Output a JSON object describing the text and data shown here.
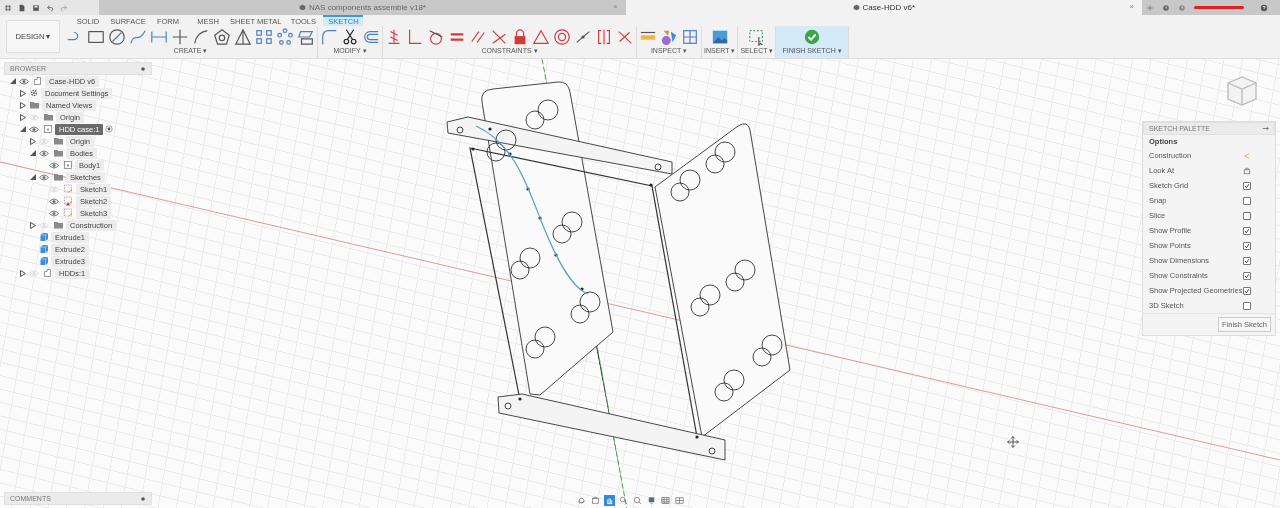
{
  "top_bar": {
    "document_tabs": [
      {
        "title": "NAS components assemble v18*",
        "close": "×",
        "selected": false
      },
      {
        "title": "Case-HDD v6*",
        "close": "×",
        "selected": true
      }
    ]
  },
  "toolbar": {
    "workspace": "DESIGN ▾",
    "tabs": [
      {
        "label": "SOLID",
        "selected": false
      },
      {
        "label": "SURFACE",
        "selected": false
      },
      {
        "label": "FORM",
        "selected": false
      },
      {
        "label": "MESH",
        "selected": false
      },
      {
        "label": "SHEET METAL",
        "selected": false
      },
      {
        "label": "TOOLS",
        "selected": false
      },
      {
        "label": "SKETCH",
        "selected": true
      }
    ],
    "groups": [
      {
        "label": "CREATE ▾",
        "kind": "create"
      },
      {
        "label": "MODIFY ▾",
        "kind": "modify"
      },
      {
        "label": "CONSTRAINTS ▾",
        "kind": "constraints"
      },
      {
        "label": "INSPECT ▾",
        "kind": "inspect"
      },
      {
        "label": "INSERT ▾",
        "kind": "insert"
      },
      {
        "label": "SELECT ▾",
        "kind": "select"
      },
      {
        "label": "FINISH SKETCH ▾",
        "kind": "finish"
      }
    ]
  },
  "browser": {
    "title": "BROWSER",
    "tree": [
      {
        "label": "Case-HDD v6",
        "kind": "component",
        "expanded": true,
        "visible": true,
        "selected": false,
        "children": [
          {
            "label": "Document Settings",
            "kind": "settings",
            "expanded": false,
            "selected": false
          },
          {
            "label": "Named Views",
            "kind": "folder",
            "expanded": false,
            "selected": false
          },
          {
            "label": "Origin",
            "kind": "folder",
            "expanded": false,
            "visible": false,
            "selected": false
          },
          {
            "label": "HDD case:1",
            "kind": "body",
            "expanded": true,
            "visible": true,
            "selected": true,
            "children": [
              {
                "label": "Origin",
                "kind": "folder",
                "expanded": false,
                "visible": false,
                "selected": false
              },
              {
                "label": "Bodies",
                "kind": "folder",
                "expanded": true,
                "visible": true,
                "selected": false,
                "children": [
                  {
                    "label": "Body1",
                    "kind": "body",
                    "visible": true,
                    "selected": false
                  }
                ]
              },
              {
                "label": "Sketches",
                "kind": "folder",
                "expanded": true,
                "visible": true,
                "selected": false,
                "children": [
                  {
                    "label": "Sketch1",
                    "kind": "sketch",
                    "visible": false,
                    "warning": false,
                    "selected": false
                  },
                  {
                    "label": "Sketch2",
                    "kind": "sketch",
                    "visible": true,
                    "warning": true,
                    "selected": false
                  },
                  {
                    "label": "Sketch3",
                    "kind": "sketch",
                    "visible": true,
                    "warning": false,
                    "selected": false
                  }
                ]
              },
              {
                "label": "Construction",
                "kind": "folder",
                "expanded": false,
                "visible": false,
                "selected": false
              },
              {
                "label": "Extrude1",
                "kind": "extrude",
                "selected": false
              },
              {
                "label": "Extrude2",
                "kind": "extrude",
                "selected": false
              },
              {
                "label": "Extrude3",
                "kind": "extrude",
                "selected": false
              }
            ]
          },
          {
            "label": "HDDs:1",
            "kind": "component",
            "expanded": false,
            "visible": false,
            "selected": false
          }
        ]
      }
    ]
  },
  "sketch_palette": {
    "title": "SKETCH PALETTE",
    "section": "Options",
    "options": [
      {
        "label": "Construction",
        "kind": "construction"
      },
      {
        "label": "Look At",
        "kind": "look-at"
      },
      {
        "label": "Sketch Grid",
        "kind": "checkbox",
        "checked": true
      },
      {
        "label": "Snap",
        "kind": "checkbox",
        "checked": false
      },
      {
        "label": "Slice",
        "kind": "checkbox",
        "checked": false
      },
      {
        "label": "Show Profile",
        "kind": "checkbox",
        "checked": true
      },
      {
        "label": "Show Points",
        "kind": "checkbox",
        "checked": true
      },
      {
        "label": "Show Dimensions",
        "kind": "checkbox",
        "checked": true
      },
      {
        "label": "Show Constraints",
        "kind": "checkbox",
        "checked": true
      },
      {
        "label": "Show Projected Geometries",
        "kind": "checkbox",
        "checked": true
      },
      {
        "label": "3D Sketch",
        "kind": "checkbox",
        "checked": false
      }
    ],
    "finish_button": "Finish Sketch"
  },
  "comments": {
    "title": "COMMENTS"
  },
  "nav_tools": [
    {
      "selected": false
    },
    {
      "selected": false
    },
    {
      "selected": true
    },
    {
      "selected": false
    },
    {
      "selected": false
    },
    {
      "selected": false
    },
    {
      "selected": false
    },
    {
      "selected": false
    }
  ]
}
